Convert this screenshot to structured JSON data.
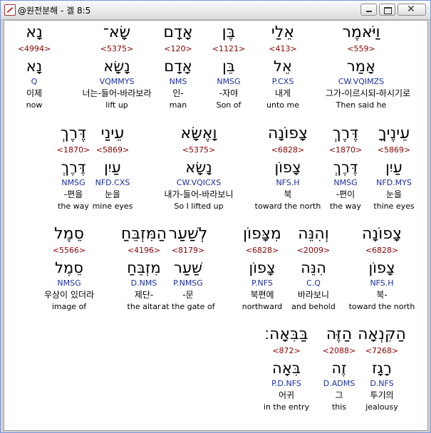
{
  "window": {
    "title": "@원전분해 - 겔 8:5"
  },
  "rows": [
    [
      {
        "heb": "וַיֹּאמֶר",
        "strong": "<559>",
        "lemma": "אָמַר",
        "morph": "CW.VQIMZS",
        "korean": "그가-이르시되-하시기로",
        "english": "Then said he"
      },
      {
        "heb": "אֵלַי",
        "strong": "<413>",
        "lemma": "אֵל",
        "morph": "P.CXS",
        "korean": "내게",
        "english": "unto me"
      },
      {
        "heb": "בֶּן",
        "strong": "<1121>",
        "lemma": "בֵּן",
        "morph": "NMSG",
        "korean": "-자야",
        "english": "Son of"
      },
      {
        "heb": "אָדָם",
        "strong": "<120>",
        "lemma": "אָדָם",
        "morph": "NMS",
        "korean": "인-",
        "english": "man"
      },
      {
        "heb": "שָׂא־",
        "strong": "<5375>",
        "lemma": "נָשָׂא",
        "morph": "VQMMYS",
        "korean": "너는-들어-바라보라",
        "english": "lift up"
      },
      {
        "heb": "נָא",
        "strong": "<4994>",
        "lemma": "נָא",
        "morph": "Q",
        "korean": "이제",
        "english": "now"
      }
    ],
    [
      {
        "heb": "עֵינֶיךָ",
        "strong": "<5869>",
        "lemma": "עַיִן",
        "morph": "NFD.MYS",
        "korean": "눈을",
        "english": "thine eyes"
      },
      {
        "heb": "דֶּרֶךְ",
        "strong": "<1870>",
        "lemma": "דֶּרֶךְ",
        "morph": "NMSG",
        "korean": "-편이",
        "english": "the way"
      },
      {
        "heb": "צָפוֹנָה",
        "strong": "<6828>",
        "lemma": "צָפוֹן",
        "morph": "NFS.H",
        "korean": "북",
        "english": "toward the north"
      },
      {
        "heb": "וָאֶשָּׂא",
        "strong": "<5375>",
        "lemma": "נָשָׂא",
        "morph": "CW.VQICXS",
        "korean": "내가-들어-바라보니",
        "english": "So I lifted up"
      },
      {
        "heb": "עֵינַי",
        "strong": "<5869>",
        "lemma": "עַיִן",
        "morph": "NFD.CXS",
        "korean": "눈을",
        "english": "mine eyes"
      },
      {
        "heb": "דֶּרֶךְ",
        "strong": "<1870>",
        "lemma": "דֶּרֶךְ",
        "morph": "NMSG",
        "korean": "-편을",
        "english": "the way"
      }
    ],
    [
      {
        "heb": "צָפוֹנָה",
        "strong": "<6828>",
        "lemma": "צָפוֹן",
        "morph": "NFS.H",
        "korean": "북-",
        "english": "toward the north"
      },
      {
        "heb": "וְהִנֵּה",
        "strong": "<2009>",
        "lemma": "הִנֵּה",
        "morph": "C.Q",
        "korean": "바라보니",
        "english": "and behold"
      },
      {
        "heb": "מִצָּפוֹן",
        "strong": "<6828>",
        "lemma": "צָפוֹן",
        "morph": "P.NFS",
        "korean": "북편에",
        "english": "northward"
      },
      {
        "heb": "לְשַׁעַר",
        "strong": "<8179>",
        "lemma": "שַׁעַר",
        "morph": "P.NMSG",
        "korean": "-문",
        "english": "at the gate of"
      },
      {
        "heb": "הַמִּזְבֵּחַ",
        "strong": "<4196>",
        "lemma": "מִזְבֵּחַ",
        "morph": "D.NMS",
        "korean": "제단-",
        "english": "the altar"
      },
      {
        "heb": "סֵמֶל",
        "strong": "<5566>",
        "lemma": "סֵמֶל",
        "morph": "NMSG",
        "korean": "우상이 있더라",
        "english": "image of"
      }
    ],
    [
      {
        "heb": "הַקִּנְאָה",
        "strong": "<7268>",
        "lemma": "רָגָז",
        "morph": "D.NFS",
        "korean": "투기의",
        "english": "jealousy"
      },
      {
        "heb": "הַזֶּה",
        "strong": "<2088>",
        "lemma": "זֶה",
        "morph": "D.ADMS",
        "korean": "그",
        "english": "this"
      },
      {
        "heb": "בַּבִּאָה׃",
        "strong": "<872>",
        "lemma": "בִּאָה",
        "morph": "P.D.NFS",
        "korean": "어귀",
        "english": "in the entry"
      }
    ]
  ]
}
